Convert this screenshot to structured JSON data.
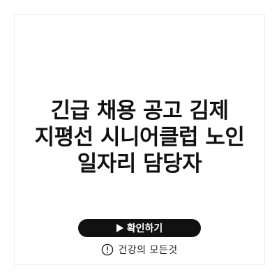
{
  "title": {
    "lines": [
      "긴급 채용 공고 김제",
      "지평선 시니어클럽 노인",
      "일자리 담당자"
    ]
  },
  "cta": {
    "label": "확인하기",
    "icon": "play-triangle-icon"
  },
  "brand": {
    "icon": "exclamation-circle-icon",
    "name": "건강의 모든것"
  },
  "colors": {
    "background": "#ffffff",
    "text": "#111111",
    "button": "#111111",
    "button_text": "#ffffff"
  }
}
